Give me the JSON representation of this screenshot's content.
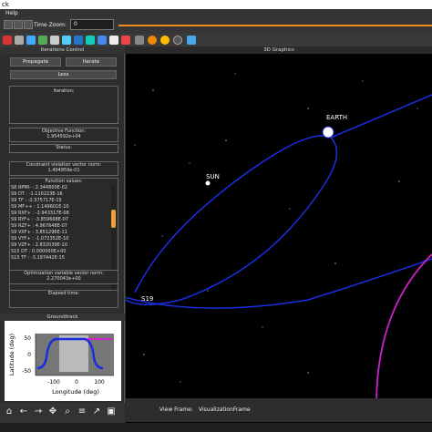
{
  "window": {
    "title_fragment": "ck",
    "menu": "Help"
  },
  "toolbar": {
    "time_zoom_label": "Time Zoom:",
    "time_zoom_value": "0"
  },
  "iterations": {
    "header": "Iterations Control",
    "propagate": "Propagate",
    "iterate": "Iterate",
    "less": "Less",
    "iteration_label": "Iteration:",
    "objective_label": "Objective Function:",
    "objective_value": "1.954592e+04",
    "status_label": "Status:",
    "constraint_label": "Constraint violation vector norm:",
    "constraint_value": "1.494959e-01",
    "function_values_label": "Function values:",
    "function_values": [
      "S8 RPMl- : 2.344800E-02",
      "S9 DT : -1.110223E-16",
      "S9 TF : -2.575717E-15",
      "S9 MF++ : 1.149601E-10",
      "S9 RXF+ : -2.943317E-08",
      "S9 RYF+ : -3.859668E-07",
      "S9 RZF+ : 4.967648E-07",
      "S9 VXF+ : 3.851296E-11",
      "S9 VYF+ : -1.072352E-10",
      "S9 VZF+ : 2.832039E-10",
      "S15 DT : 0.000000E+00",
      "S15 TF : -3.197442E-15"
    ],
    "opt_label": "Optimization variable vector norm:",
    "opt_value": "2.270043e+00",
    "elapsed_label": "Elapsed time:"
  },
  "groundtrack": {
    "header": "Groundtrack",
    "ylabel": "Latitude (deg)",
    "xlabel": "Longitude (deg)",
    "yticks": [
      "50",
      "0",
      "-50"
    ],
    "xticks": [
      "-100",
      "0",
      "100"
    ]
  },
  "view": {
    "title": "3D Graphics",
    "labels": {
      "earth": "EARTH",
      "sun": "SUN",
      "s19": "S19"
    },
    "frame_label": "View Frame:",
    "frame_value": "VisualizationFrame"
  },
  "colors": {
    "orbit": "#1a2ee0",
    "magenta": "#cc22cc",
    "accent": "#f08c1a"
  },
  "bottom_toolbar_icons": [
    "home-icon",
    "back-icon",
    "forward-icon",
    "move-icon",
    "zoom-icon",
    "settings-icon",
    "plot-icon",
    "save-icon"
  ]
}
